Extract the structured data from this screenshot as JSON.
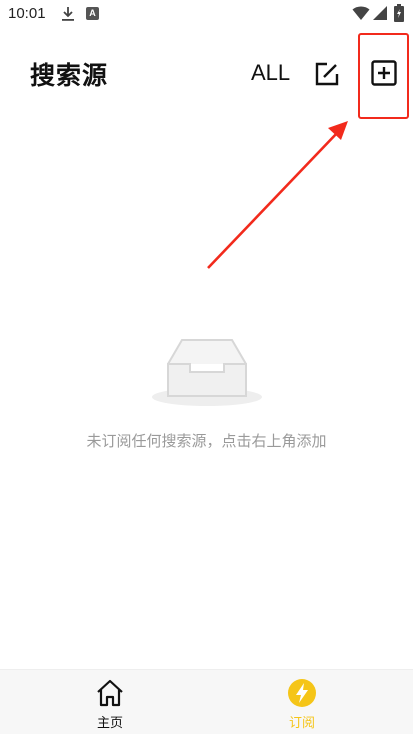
{
  "status_bar": {
    "time": "10:01",
    "notification_badge": "A"
  },
  "header": {
    "title": "搜索源",
    "all_label": "ALL"
  },
  "empty_state": {
    "message": "未订阅任何搜索源，点击右上角添加"
  },
  "bottom_nav": {
    "items": [
      {
        "label": "主页",
        "icon": "home-icon"
      },
      {
        "label": "订阅",
        "icon": "lightning-icon",
        "active": true
      }
    ]
  },
  "colors": {
    "accent": "#f5c518",
    "annotation": "#f22a1c",
    "muted_text": "#9a9a9a"
  }
}
